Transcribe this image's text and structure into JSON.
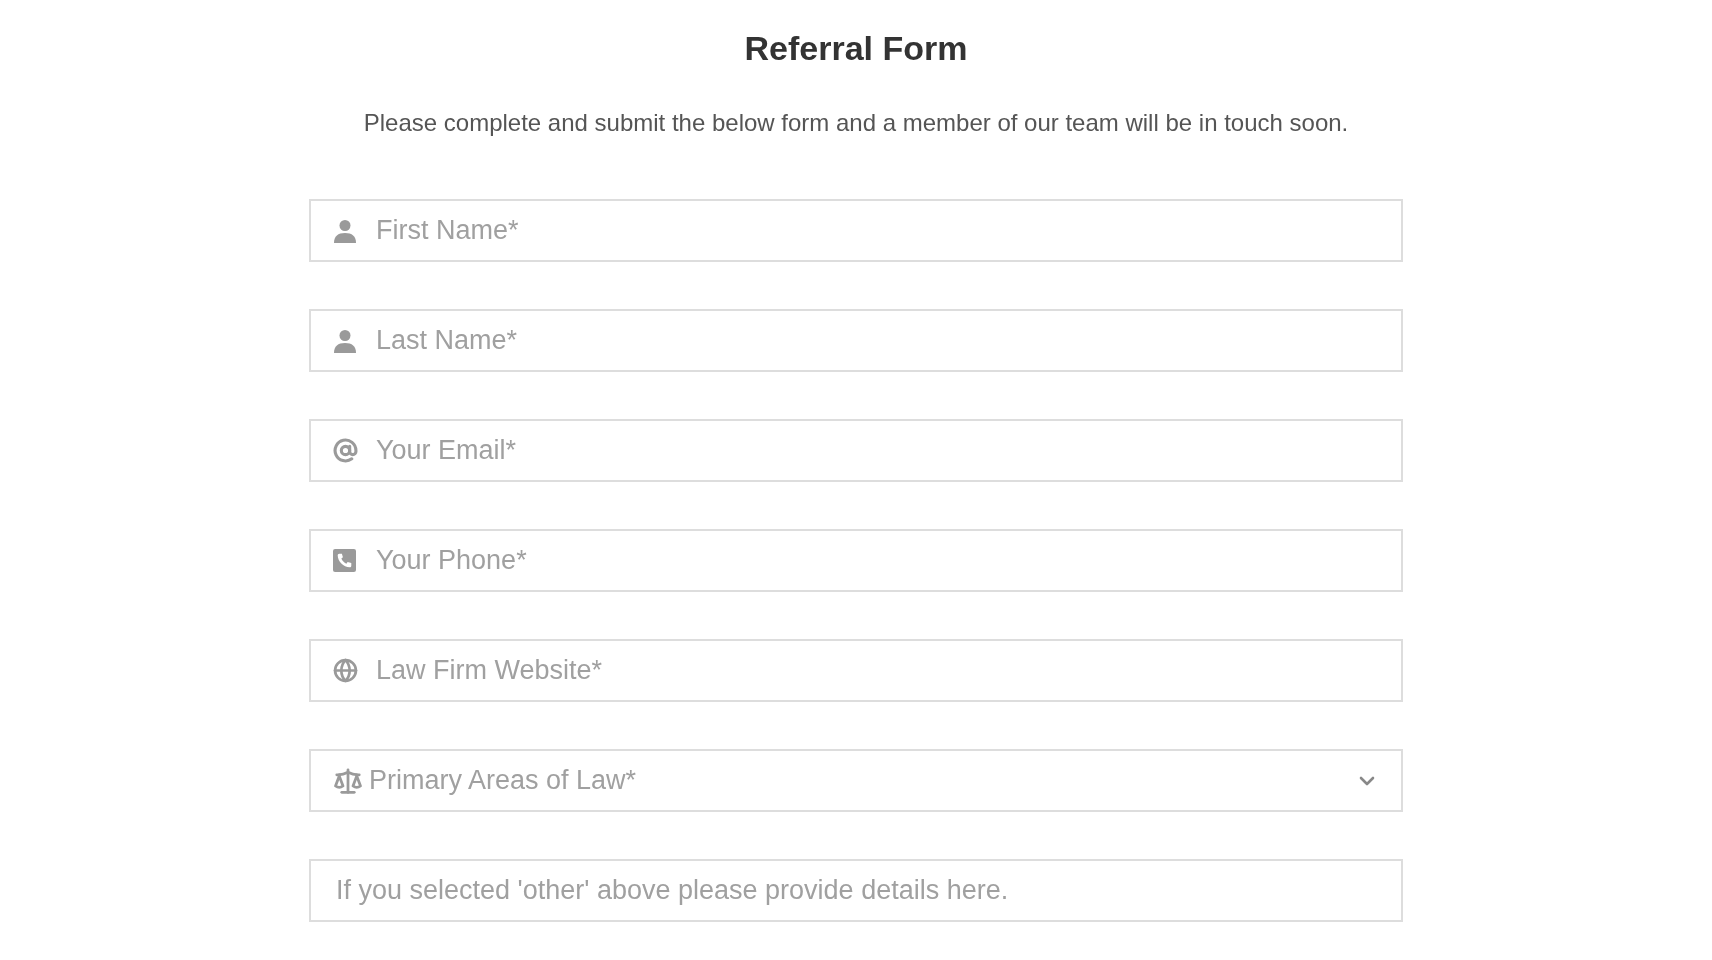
{
  "title": "Referral Form",
  "subtitle": "Please complete and submit the below form and a member of our team will be in touch soon.",
  "fields": [
    {
      "kind": "name",
      "placeholder": "First Name*"
    },
    {
      "kind": "name",
      "placeholder": "Last Name*"
    },
    {
      "kind": "email",
      "placeholder": "Your Email*"
    },
    {
      "kind": "phone",
      "placeholder": "Your Phone*"
    },
    {
      "kind": "website",
      "placeholder": "Law Firm Website*"
    },
    {
      "kind": "select",
      "placeholder": "Primary Areas of Law*"
    },
    {
      "kind": "details",
      "placeholder": "If you selected 'other' above please provide details here."
    }
  ]
}
